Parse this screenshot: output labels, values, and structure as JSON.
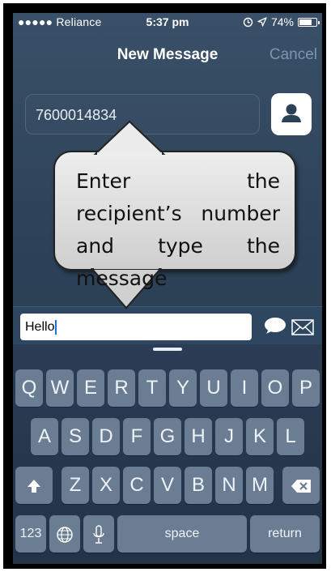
{
  "status_bar": {
    "carrier": "●●●●● Reliance",
    "time": "5:37 pm",
    "battery_percent": "74%",
    "battery_level": 0.74
  },
  "nav": {
    "title": "New Message",
    "cancel_label": "Cancel"
  },
  "recipient": {
    "value": "7600014834"
  },
  "callout": {
    "text": "Enter the recipient’s number and type the message"
  },
  "message": {
    "value": "Hello"
  },
  "keyboard": {
    "row1": [
      "Q",
      "W",
      "E",
      "R",
      "T",
      "Y",
      "U",
      "I",
      "O",
      "P"
    ],
    "row2": [
      "A",
      "S",
      "D",
      "F",
      "G",
      "H",
      "J",
      "K",
      "L"
    ],
    "row3": [
      "Z",
      "X",
      "C",
      "V",
      "B",
      "N",
      "M"
    ],
    "numbers_label": "123",
    "space_label": "space",
    "return_label": "return"
  },
  "colors": {
    "background": "#2c4157",
    "key": "#6b7d92",
    "cancel": "#7f95ad"
  }
}
